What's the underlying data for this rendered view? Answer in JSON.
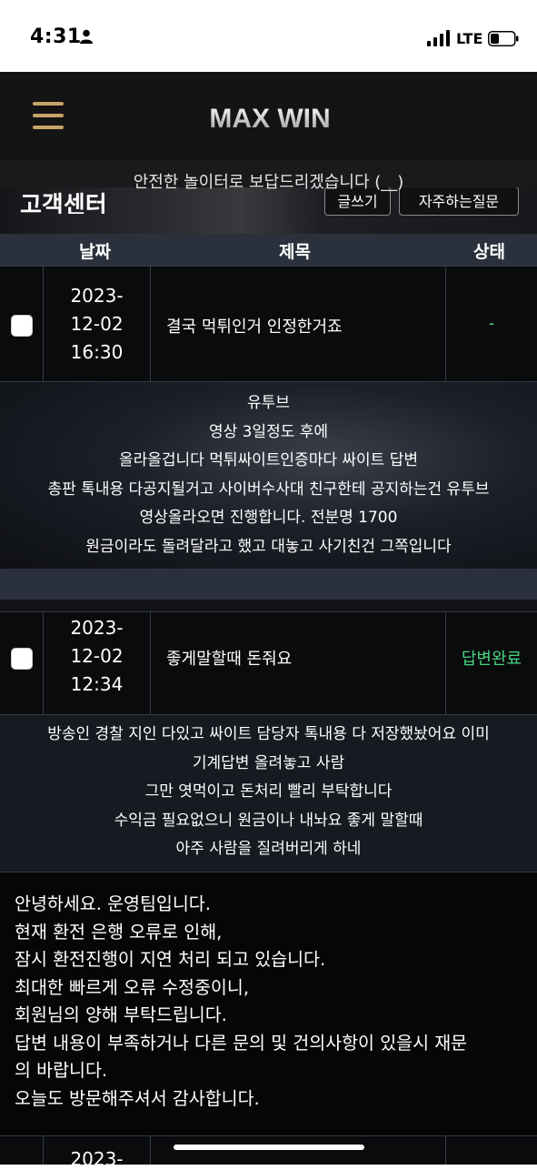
{
  "status_bar": {
    "time": "4:31",
    "network": "LTE"
  },
  "header": {
    "logo_text": "MAX WIN",
    "accent_color": "#c8a46a"
  },
  "notice": {
    "text": "안전한 놀이터로 보답드리겠습니다 (__)"
  },
  "banner": {
    "title": "고객센터",
    "buttons": [
      "글쓰기",
      "자주하는질문"
    ]
  },
  "table": {
    "columns": [
      "날짜",
      "제목",
      "상태"
    ],
    "rows": [
      {
        "date_lines": [
          "2023-",
          "12-02",
          "16:30"
        ],
        "title": "결국 먹튀인거 인정한거죠",
        "status": "-",
        "content": [
          "유투브",
          "영상 3일정도 후에",
          "올라올겁니다 먹튀싸이트인증마다 싸이트 답변",
          "총판 톡내용 다공지될거고 사이버수사대 친구한테 공지하는건 유투브",
          "영상올라오면 진행합니다. 전분명 1700",
          "원금이라도 돌려달라고 했고 대놓고 사기친건 그쪽입니다"
        ]
      },
      {
        "date_lines": [
          "2023-",
          "12-02",
          "12:34"
        ],
        "title": "좋게말할때 돈줘요",
        "status": "답변완료",
        "content": [
          "방송인 경찰 지인 다있고 싸이트 담당자 톡내용 다 저장했놨어요 이미",
          "기계답변 올려놓고 사람",
          "그만 엿먹이고 돈처리 빨리 부탁합니다",
          "수익금 필요없으니 원금이나 내놔요 좋게 말할때",
          "아주 사람을 질려버리게 하네"
        ],
        "answer": [
          "안녕하세요. 운영팀입니다.",
          "현재 환전 은행 오류로 인해,",
          "잠시 환전진행이 지연 처리 되고 있습니다.",
          "최대한 빠르게 오류 수정중이니,",
          "회원님의 양해 부탁드립니다.",
          "답변 내용이 부족하거나 다른 문의 및 건의사항이 있을시 재문",
          "의 바랍니다.",
          "오늘도 방문해주셔서 감사합니다."
        ]
      },
      {
        "date_lines": [
          "2023-"
        ]
      }
    ]
  },
  "colors": {
    "status_done": "#47d37f",
    "table_header_bg": "#2b313c"
  }
}
